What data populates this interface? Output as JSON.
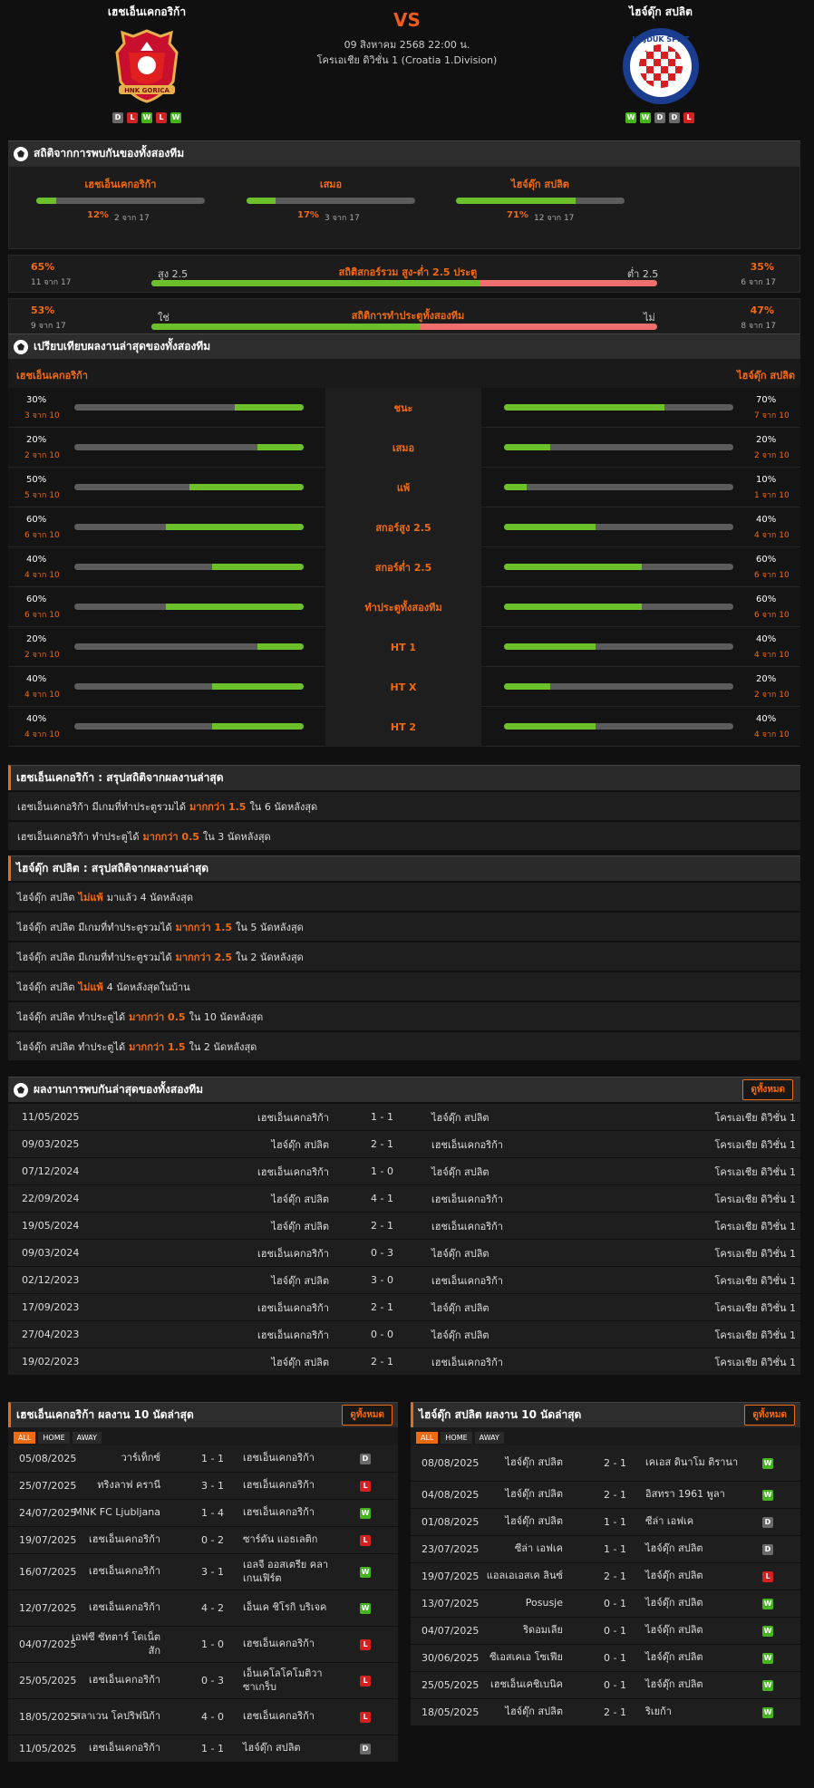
{
  "match": {
    "home": "เฮชเอ็นเคกอริก้า",
    "away": "ไฮจ์ดุ๊ก สปลิต",
    "vs": "VS",
    "date": "09 สิงหาคม 2568 22:00 น.",
    "league": "โครเอเชีย ดิวิชั่น 1 (Croatia 1.Division)",
    "home_form": [
      "D",
      "L",
      "W",
      "L",
      "W"
    ],
    "away_form": [
      "W",
      "W",
      "D",
      "D",
      "L"
    ],
    "home_logo_text": "HNK GORICA",
    "away_logo_text": "HAJDUK SPLIT"
  },
  "h2h_stats": {
    "title": "สถิติจากการพบกันของทั้งสองทีม",
    "cols": [
      {
        "label": "เฮชเอ็นเคกอริก้า",
        "pct": "12%",
        "sub": "2 จาก 17",
        "fill": 0.12
      },
      {
        "label": "เสมอ",
        "pct": "17%",
        "sub": "3 จาก 17",
        "fill": 0.17
      },
      {
        "label": "ไฮจ์ดุ๊ก สปลิต",
        "pct": "71%",
        "sub": "12 จาก 17",
        "fill": 0.71
      }
    ],
    "ou": {
      "lp": "65%",
      "ls": "11 จาก 17",
      "ltag": "สูง 2.5",
      "mid": "สถิติสกอร์รวม สูง-ต่ำ 2.5 ประตู",
      "rtag": "ต่ำ 2.5",
      "rp": "35%",
      "rs": "6 จาก 17",
      "fill": 0.65
    },
    "btts": {
      "lp": "53%",
      "ls": "9 จาก 17",
      "ltag": "ใช่",
      "mid": "สถิติการทำประตูทั้งสองทีม",
      "rtag": "ไม่",
      "rp": "47%",
      "rs": "8 จาก 17",
      "fill": 0.53
    }
  },
  "compare": {
    "title": "เปรียบเทียบผลงานล่าสุดของทั้งสองทีม",
    "home": "เฮชเอ็นเคกอริก้า",
    "away": "ไฮจ์ดุ๊ก สปลิต",
    "rows": [
      {
        "l": "30%",
        "ls": "3 จาก 10",
        "lf": 0.3,
        "m": "ชนะ",
        "r": "70%",
        "rs": "7 จาก 10",
        "rf": 0.7
      },
      {
        "l": "20%",
        "ls": "2 จาก 10",
        "lf": 0.2,
        "m": "เสมอ",
        "r": "20%",
        "rs": "2 จาก 10",
        "rf": 0.2
      },
      {
        "l": "50%",
        "ls": "5 จาก 10",
        "lf": 0.5,
        "m": "แพ้",
        "r": "10%",
        "rs": "1 จาก 10",
        "rf": 0.1
      },
      {
        "l": "60%",
        "ls": "6 จาก 10",
        "lf": 0.6,
        "m": "สกอร์สูง 2.5",
        "r": "40%",
        "rs": "4 จาก 10",
        "rf": 0.4
      },
      {
        "l": "40%",
        "ls": "4 จาก 10",
        "lf": 0.4,
        "m": "สกอร์ต่ำ 2.5",
        "r": "60%",
        "rs": "6 จาก 10",
        "rf": 0.6
      },
      {
        "l": "60%",
        "ls": "6 จาก 10",
        "lf": 0.6,
        "m": "ทำประตูทั้งสองทีม",
        "r": "60%",
        "rs": "6 จาก 10",
        "rf": 0.6
      },
      {
        "l": "20%",
        "ls": "2 จาก 10",
        "lf": 0.2,
        "m": "HT 1",
        "r": "40%",
        "rs": "4 จาก 10",
        "rf": 0.4
      },
      {
        "l": "40%",
        "ls": "4 จาก 10",
        "lf": 0.4,
        "m": "HT X",
        "r": "20%",
        "rs": "2 จาก 10",
        "rf": 0.2
      },
      {
        "l": "40%",
        "ls": "4 จาก 10",
        "lf": 0.4,
        "m": "HT 2",
        "r": "40%",
        "rs": "4 จาก 10",
        "rf": 0.4
      }
    ]
  },
  "home_summary": {
    "title": "เฮชเอ็นเคกอริก้า : สรุปสถิติจากผลงานล่าสุด",
    "rows": [
      [
        "เฮชเอ็นเคกอริก้า  มีเกมที่ทำประตูรวมได้",
        "มากกว่า  1.5",
        "ใน 6 นัดหลังสุด"
      ],
      [
        "เฮชเอ็นเคกอริก้า  ทำประตูได้",
        "มากกว่า  0.5",
        "ใน 3 นัดหลังสุด"
      ]
    ]
  },
  "away_summary": {
    "title": "ไฮจ์ดุ๊ก สปลิต : สรุปสถิติจากผลงานล่าสุด",
    "rows": [
      [
        "ไฮจ์ดุ๊ก สปลิต",
        "ไม่แพ้",
        "มาแล้ว 4 นัดหลังสุด"
      ],
      [
        "ไฮจ์ดุ๊ก สปลิต  มีเกมที่ทำประตูรวมได้",
        "มากกว่า  1.5",
        "ใน 5 นัดหลังสุด"
      ],
      [
        "ไฮจ์ดุ๊ก สปลิต  มีเกมที่ทำประตูรวมได้",
        "มากกว่า  2.5",
        "ใน 2 นัดหลังสุด"
      ],
      [
        "ไฮจ์ดุ๊ก สปลิต",
        "ไม่แพ้",
        "4  นัดหลังสุดในบ้าน"
      ],
      [
        "ไฮจ์ดุ๊ก สปลิต  ทำประตูได้",
        "มากกว่า  0.5",
        "ใน 10 นัดหลังสุด"
      ],
      [
        "ไฮจ์ดุ๊ก สปลิต  ทำประตูได้",
        "มากกว่า  1.5",
        "ใน 2 นัดหลังสุด"
      ]
    ]
  },
  "h2h": {
    "title": "ผลงานการพบกันล่าสุดของทั้งสองทีม",
    "btn": "ดูทั้งหมด",
    "rows": [
      [
        "11/05/2025",
        "เฮชเอ็นเคกอริก้า",
        "1 - 1",
        "ไฮจ์ดุ๊ก สปลิต",
        "โครเอเชีย ดิวิชั่น 1"
      ],
      [
        "09/03/2025",
        "ไฮจ์ดุ๊ก สปลิต",
        "2 - 1",
        "เฮชเอ็นเคกอริก้า",
        "โครเอเชีย ดิวิชั่น 1"
      ],
      [
        "07/12/2024",
        "เฮชเอ็นเคกอริก้า",
        "1 - 0",
        "ไฮจ์ดุ๊ก สปลิต",
        "โครเอเชีย ดิวิชั่น 1"
      ],
      [
        "22/09/2024",
        "ไฮจ์ดุ๊ก สปลิต",
        "4 - 1",
        "เฮชเอ็นเคกอริก้า",
        "โครเอเชีย ดิวิชั่น 1"
      ],
      [
        "19/05/2024",
        "ไฮจ์ดุ๊ก สปลิต",
        "2 - 1",
        "เฮชเอ็นเคกอริก้า",
        "โครเอเชีย ดิวิชั่น 1"
      ],
      [
        "09/03/2024",
        "เฮชเอ็นเคกอริก้า",
        "0 - 3",
        "ไฮจ์ดุ๊ก สปลิต",
        "โครเอเชีย ดิวิชั่น 1"
      ],
      [
        "02/12/2023",
        "ไฮจ์ดุ๊ก สปลิต",
        "3 - 0",
        "เฮชเอ็นเคกอริก้า",
        "โครเอเชีย ดิวิชั่น 1"
      ],
      [
        "17/09/2023",
        "เฮชเอ็นเคกอริก้า",
        "2 - 1",
        "ไฮจ์ดุ๊ก สปลิต",
        "โครเอเชีย ดิวิชั่น 1"
      ],
      [
        "27/04/2023",
        "เฮชเอ็นเคกอริก้า",
        "0 - 0",
        "ไฮจ์ดุ๊ก สปลิต",
        "โครเอเชีย ดิวิชั่น 1"
      ],
      [
        "19/02/2023",
        "ไฮจ์ดุ๊ก สปลิต",
        "2 - 1",
        "เฮชเอ็นเคกอริก้า",
        "โครเอเชีย ดิวิชั่น 1"
      ]
    ]
  },
  "home_last": {
    "title": "เฮชเอ็นเคกอริก้า ผลงาน 10 นัดล่าสุด",
    "btn": "ดูทั้งหมด",
    "tabs": [
      "ALL",
      "HOME",
      "AWAY"
    ],
    "rows": [
      [
        "05/08/2025",
        "วาร์เท็กซ์",
        "1 - 1",
        "เฮชเอ็นเคกอริก้า",
        "D"
      ],
      [
        "25/07/2025",
        "ทริงลาฟ ครานี",
        "3 - 1",
        "เฮชเอ็นเคกอริก้า",
        "L"
      ],
      [
        "24/07/2025",
        "MNK FC Ljubljana",
        "1 - 4",
        "เฮชเอ็นเคกอริก้า",
        "W"
      ],
      [
        "19/07/2025",
        "เฮชเอ็นเคกอริก้า",
        "0 - 2",
        "ซาร์ดัน แอธเลติก",
        "L"
      ],
      [
        "16/07/2025",
        "เฮชเอ็นเคกอริก้า",
        "3 - 1",
        "เอลจี ออสเตรีย คลาเกนเฟิร์ต",
        "W"
      ],
      [
        "12/07/2025",
        "เฮชเอ็นเคกอริก้า",
        "4 - 2",
        "เอ็นเค ชิโรกิ บริเจค",
        "W"
      ],
      [
        "04/07/2025",
        "เอฟซี ซัทตาร์ โดเน็ตสัก",
        "1 - 0",
        "เฮชเอ็นเคกอริก้า",
        "L"
      ],
      [
        "25/05/2025",
        "เฮชเอ็นเคกอริก้า",
        "0 - 3",
        "เอ็นเคโลโคโมติวา ซาเกร็บ",
        "L"
      ],
      [
        "18/05/2025",
        "สลาเวน โคปริฟนิก้า",
        "4 - 0",
        "เฮชเอ็นเคกอริก้า",
        "L"
      ],
      [
        "11/05/2025",
        "เฮชเอ็นเคกอริก้า",
        "1 - 1",
        "ไฮจ์ดุ๊ก สปลิต",
        "D"
      ]
    ]
  },
  "away_last": {
    "title": "ไฮจ์ดุ๊ก สปลิต ผลงาน 10 นัดล่าสุด",
    "btn": "ดูทั้งหมด",
    "tabs": [
      "ALL",
      "HOME",
      "AWAY"
    ],
    "rows": [
      [
        "08/08/2025",
        "ไฮจ์ดุ๊ก สปลิต",
        "2 - 1",
        "เคเอส ดินาโม ติรานา",
        "W"
      ],
      [
        "04/08/2025",
        "ไฮจ์ดุ๊ก สปลิต",
        "2 - 1",
        "อิสทรา 1961 พูลา",
        "W"
      ],
      [
        "01/08/2025",
        "ไฮจ์ดุ๊ก สปลิต",
        "1 - 1",
        "ซีล่า เอฟเค",
        "D"
      ],
      [
        "23/07/2025",
        "ซีล่า เอฟเค",
        "1 - 1",
        "ไฮจ์ดุ๊ก สปลิต",
        "D"
      ],
      [
        "19/07/2025",
        "แอลเอเอสเค ลินซ์",
        "2 - 1",
        "ไฮจ์ดุ๊ก สปลิต",
        "L"
      ],
      [
        "13/07/2025",
        "Posusje",
        "0 - 1",
        "ไฮจ์ดุ๊ก สปลิต",
        "W"
      ],
      [
        "04/07/2025",
        "ริดอมเลีย",
        "0 - 1",
        "ไฮจ์ดุ๊ก สปลิต",
        "W"
      ],
      [
        "30/06/2025",
        "ซีเอสเคเอ โซเฟีย",
        "0 - 1",
        "ไฮจ์ดุ๊ก สปลิต",
        "W"
      ],
      [
        "25/05/2025",
        "เฮชเอ็นเคชิเบนิค",
        "0 - 1",
        "ไฮจ์ดุ๊ก สปลิต",
        "W"
      ],
      [
        "18/05/2025",
        "ไฮจ์ดุ๊ก สปลิต",
        "2 - 1",
        "ริเยก้า",
        "W"
      ]
    ]
  },
  "colors": {
    "accent": "#f06a12",
    "win": "#45b51d",
    "loss": "#d42020",
    "draw": "#6a6a6a",
    "bar_fill": "#6cc02a",
    "ou_right": "#f07070"
  }
}
